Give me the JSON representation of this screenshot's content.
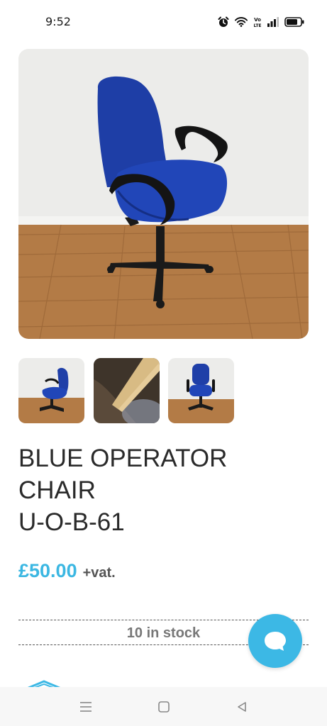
{
  "status_bar": {
    "time": "9:52",
    "volte_label": "Vo\nLTE",
    "icons": [
      "alarm-icon",
      "wifi-icon",
      "volte-icon",
      "signal-icon",
      "battery-icon"
    ]
  },
  "product": {
    "title_lines": [
      "BLUE OPERATOR",
      "CHAIR",
      "U-O-B-61"
    ],
    "price": "£50.00",
    "vat_label": "+vat.",
    "stock": "10 in stock",
    "images": {
      "main": "blue-operator-chair-photo",
      "thumbnails": [
        "chair-side-view",
        "chair-seat-underside-detail",
        "chair-back-view"
      ]
    }
  },
  "chat": {
    "icon": "chat-bubble-icon"
  },
  "nav": {
    "icons": [
      "menu-icon",
      "home-icon",
      "back-icon"
    ]
  },
  "colors": {
    "accent": "#3cb8e5",
    "price": "#3bb7e2",
    "chair_blue": "#1f3fa8",
    "floor": "#b07a45",
    "wall": "#ececea"
  }
}
